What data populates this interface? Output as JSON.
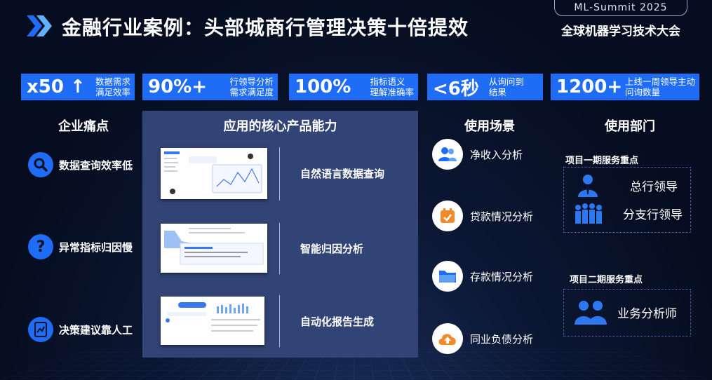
{
  "header": {
    "title": "金融行业案例：头部城商行管理决策十倍提效",
    "event_tag": "ML-Summit 2025",
    "conference_name": "全球机器学习技术大会"
  },
  "metrics": [
    {
      "value": "x50 ↑",
      "desc1": "数据需求",
      "desc2": "满足效率"
    },
    {
      "value": "90%+",
      "desc1": "行领导分析",
      "desc2": "需求满足度"
    },
    {
      "value": "100%",
      "desc1": "指标语义",
      "desc2": "理解准确率"
    },
    {
      "value": "<6秒",
      "desc1": "从询问到",
      "desc2": "结果"
    },
    {
      "value": "1200+",
      "desc1": "上线一周领导主动",
      "desc2": "问询数量"
    }
  ],
  "columns": {
    "pain_points": "企业痛点",
    "capabilities": "应用的核心产品能力",
    "scenarios": "使用场景",
    "departments": "使用部门"
  },
  "pain_points": [
    {
      "icon": "search-icon",
      "label": "数据查询效率低"
    },
    {
      "icon": "question-icon",
      "label": "异常指标归因慢"
    },
    {
      "icon": "document-chart-icon",
      "label": "决策建议靠人工"
    }
  ],
  "capabilities": [
    {
      "label": "自然语言数据查询"
    },
    {
      "label": "智能归因分析"
    },
    {
      "label": "自动化报告生成"
    }
  ],
  "scenarios": [
    {
      "icon": "users-icon",
      "label": "净收入分析"
    },
    {
      "icon": "calendar-check-icon",
      "label": "贷款情况分析"
    },
    {
      "icon": "folder-icon",
      "label": "存款情况分析"
    },
    {
      "icon": "cloud-upload-icon",
      "label": "同业负债分析"
    }
  ],
  "departments": {
    "phase1_label": "项目一期服务重点",
    "phase1_items": [
      {
        "icon": "leader-icon",
        "label": "总行领导"
      },
      {
        "icon": "group-icon",
        "label": "分支行领导"
      }
    ],
    "phase2_label": "项目二期服务重点",
    "phase2_items": [
      {
        "icon": "analysts-icon",
        "label": "业务分析师"
      }
    ]
  },
  "colors": {
    "accent": "#1f6cf6",
    "panel": "#324475",
    "background": "#071126"
  }
}
